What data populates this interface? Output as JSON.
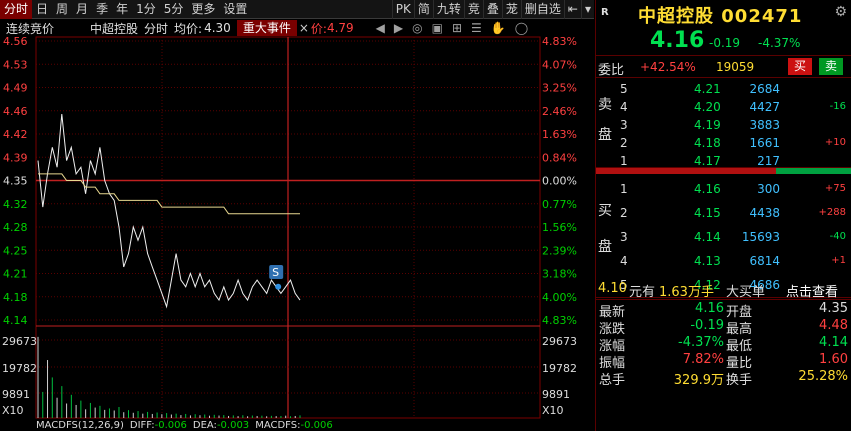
{
  "toolbar": {
    "tabs": [
      "分时",
      "日",
      "周",
      "月",
      "季",
      "年",
      "1分",
      "5分",
      "更多",
      "设置"
    ],
    "right_tools": [
      "PK",
      "简",
      "九转",
      "竞",
      "叠",
      "茏",
      "删自选",
      "⇤",
      "▾"
    ]
  },
  "subheader": {
    "mode": "连续竞价",
    "name": "中超控股",
    "period": "分时",
    "avg_label": "均价:",
    "avg_value": "4.30",
    "event_tag": "重大事件",
    "event_close": "×",
    "price_label": "价:",
    "price_value": "4.79"
  },
  "chart_data": {
    "type": "line",
    "price_ticks_left": [
      "4.56",
      "4.53",
      "4.49",
      "4.46",
      "4.42",
      "4.39",
      "4.35",
      "4.32",
      "4.28",
      "4.25",
      "4.21",
      "4.18",
      "4.14"
    ],
    "pct_ticks_right": [
      "4.83%",
      "4.07%",
      "3.25%",
      "2.46%",
      "1.63%",
      "0.84%",
      "0.00%",
      "0.77%",
      "1.56%",
      "2.39%",
      "3.18%",
      "4.00%",
      "4.83%"
    ],
    "prev_close": 4.35,
    "ylim": [
      4.14,
      4.56
    ],
    "volume_ticks_left": [
      "29673",
      "19782",
      "9891",
      "X10"
    ],
    "volume_ticks_right": [
      "29673",
      "19782",
      "9891",
      "X10"
    ],
    "marker_label": "S",
    "price_series": [
      4.38,
      4.31,
      4.36,
      4.4,
      4.37,
      4.45,
      4.38,
      4.4,
      4.36,
      4.37,
      4.33,
      4.38,
      4.36,
      4.4,
      4.35,
      4.33,
      4.32,
      4.28,
      4.22,
      4.24,
      4.28,
      4.26,
      4.28,
      4.24,
      4.22,
      4.2,
      4.18,
      4.16,
      4.2,
      4.24,
      4.2,
      4.19,
      4.21,
      4.19,
      4.21,
      4.19,
      4.2,
      4.18,
      4.17,
      4.19,
      4.17,
      4.18,
      4.2,
      4.18,
      4.17,
      4.19,
      4.2,
      4.19,
      4.18,
      4.2,
      4.19,
      4.18,
      4.19,
      4.2,
      4.18,
      4.17
    ],
    "avg_series": [
      4.36,
      4.36,
      4.36,
      4.36,
      4.36,
      4.36,
      4.35,
      4.35,
      4.35,
      4.35,
      4.34,
      4.34,
      4.34,
      4.33,
      4.33,
      4.33,
      4.33,
      4.32,
      4.32,
      4.32,
      4.32,
      4.32,
      4.32,
      4.32,
      4.32,
      4.32,
      4.31,
      4.31,
      4.31,
      4.31,
      4.31,
      4.31,
      4.31,
      4.31,
      4.31,
      4.31,
      4.31,
      4.31,
      4.31,
      4.31,
      4.3,
      4.3,
      4.3,
      4.3,
      4.3,
      4.3,
      4.3,
      4.3,
      4.3,
      4.3,
      4.3,
      4.3,
      4.3,
      4.3,
      4.3,
      4.3
    ],
    "volume_series": [
      28000,
      9000,
      20000,
      14000,
      7000,
      11000,
      5000,
      8000,
      4500,
      6000,
      3000,
      5200,
      3600,
      4200,
      2800,
      3300,
      2600,
      3800,
      2000,
      2700,
      1800,
      2400,
      1500,
      2100,
      1400,
      1900,
      1300,
      1700,
      1200,
      1500,
      1000,
      1400,
      900,
      1300,
      950,
      1200,
      800,
      1100,
      850,
      1000,
      700,
      900,
      650,
      950,
      600,
      850,
      700,
      800,
      600,
      750,
      650,
      700,
      800,
      600,
      700,
      900
    ]
  },
  "macd": {
    "label": "MACDFS(12,26,9)",
    "dif_label": "DIFF:",
    "dif_value": "-0.006",
    "dea_label": "DEA:",
    "dea_value": "-0.003",
    "macd_label": "MACDFS:",
    "macd_value": "-0.006"
  },
  "quote": {
    "badge": "R",
    "title": "中超控股 002471",
    "price": "4.16",
    "change": "-0.19",
    "change_pct": "-4.37%",
    "ratio_label": "委比",
    "ratio_value": "+42.54%",
    "ratio_diff": "19059",
    "sell_btn": "买",
    "buy_btn": "卖",
    "sell_side_label": [
      "卖",
      "盘"
    ],
    "buy_side_label": [
      "买",
      "盘"
    ],
    "asks": [
      {
        "level": "5",
        "price": "4.21",
        "volume": "2684",
        "delta": ""
      },
      {
        "level": "4",
        "price": "4.20",
        "volume": "4427",
        "delta": "-16"
      },
      {
        "level": "3",
        "price": "4.19",
        "volume": "3883",
        "delta": ""
      },
      {
        "level": "2",
        "price": "4.18",
        "volume": "1661",
        "delta": "+10"
      },
      {
        "level": "1",
        "price": "4.17",
        "volume": "217",
        "delta": ""
      }
    ],
    "bids": [
      {
        "level": "1",
        "price": "4.16",
        "volume": "300",
        "delta": "+75"
      },
      {
        "level": "2",
        "price": "4.15",
        "volume": "4438",
        "delta": "+288"
      },
      {
        "level": "3",
        "price": "4.14",
        "volume": "15693",
        "delta": "-40"
      },
      {
        "level": "4",
        "price": "4.13",
        "volume": "6814",
        "delta": "+1"
      },
      {
        "level": "5",
        "price": "4.12",
        "volume": "4686",
        "delta": ""
      }
    ],
    "big_order": {
      "price": "4.10",
      "t1": "元有",
      "vol": "1.63万手",
      "t2": "大买单",
      "t3": "点击查看"
    },
    "stats": [
      {
        "k1": "最新",
        "v1": "4.16",
        "k2": "开盘",
        "v2": "4.35"
      },
      {
        "k1": "涨跌",
        "v1": "-0.19",
        "k2": "最高",
        "v2": "4.48"
      },
      {
        "k1": "涨幅",
        "v1": "-4.37%",
        "k2": "最低",
        "v2": "4.14"
      },
      {
        "k1": "振幅",
        "v1": "7.82%",
        "k2": "量比",
        "v2": "1.60"
      },
      {
        "k1": "总手",
        "v1": "329.9万",
        "k2": "换手",
        "v2": "25.28%"
      }
    ]
  }
}
